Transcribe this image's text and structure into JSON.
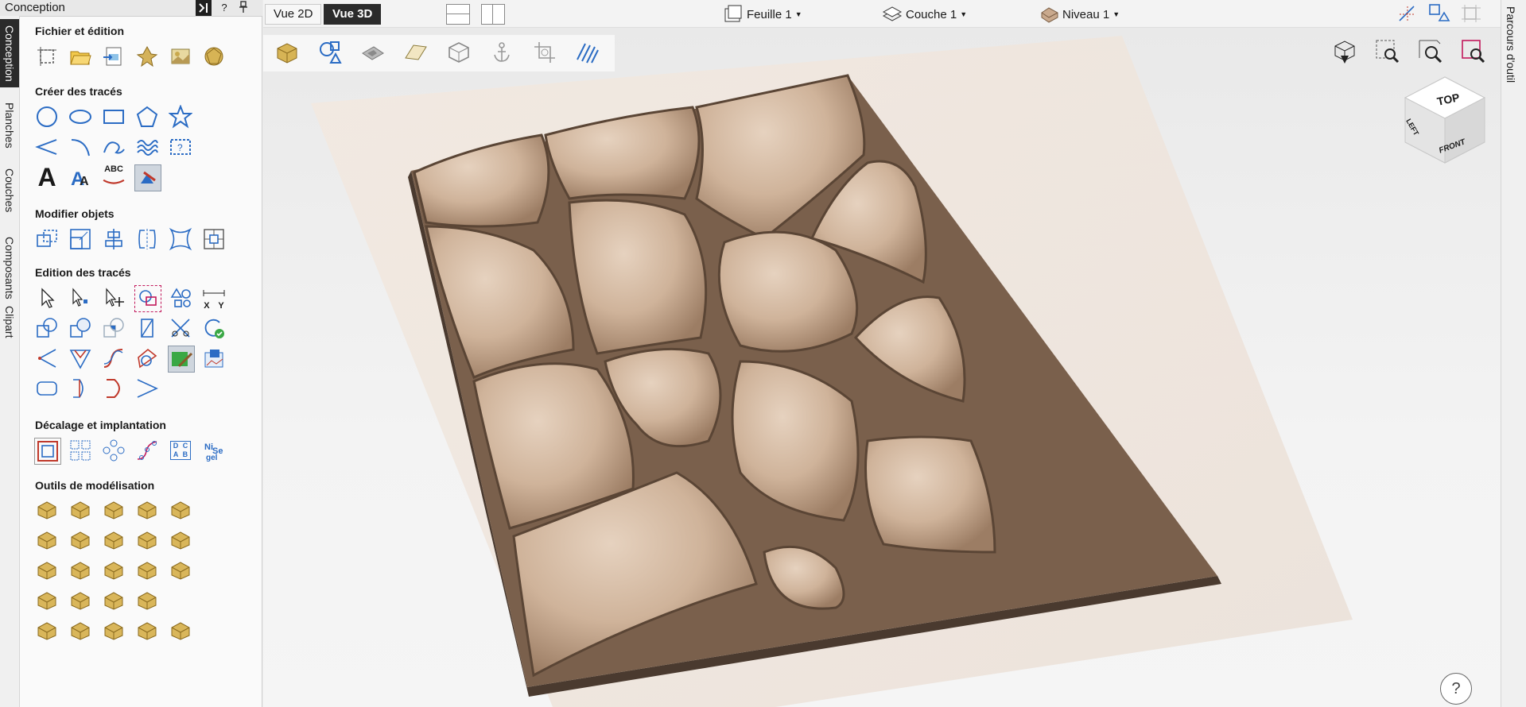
{
  "panel": {
    "title": "Conception",
    "help_label": "?",
    "sections": {
      "file": "Fichier et édition",
      "create": "Créer des tracés",
      "modify": "Modifier objets",
      "edit": "Edition des tracés",
      "offset": "Décalage et implantation",
      "modeling": "Outils de modélisation"
    },
    "edit_xy_label": "X Y",
    "dc_label": "D C A B",
    "text_A": "A",
    "text_abc": "ABC"
  },
  "vertical_tabs": [
    "Conception",
    "Planches",
    "Couches",
    "Composants",
    "Clipart"
  ],
  "topbar": {
    "view2d": "Vue 2D",
    "view3d": "Vue 3D",
    "sheet": "Feuille 1",
    "layer": "Couche 1",
    "level": "Niveau 1"
  },
  "right_tab": "Parcours d'outil",
  "viewcube": {
    "top": "TOP",
    "front": "FRONT",
    "left": "LEFT"
  },
  "help_button": "?",
  "colors": {
    "accent": "#2b6cc4",
    "wood": "#c9a98d",
    "dark_tab": "#2b2b2b"
  }
}
